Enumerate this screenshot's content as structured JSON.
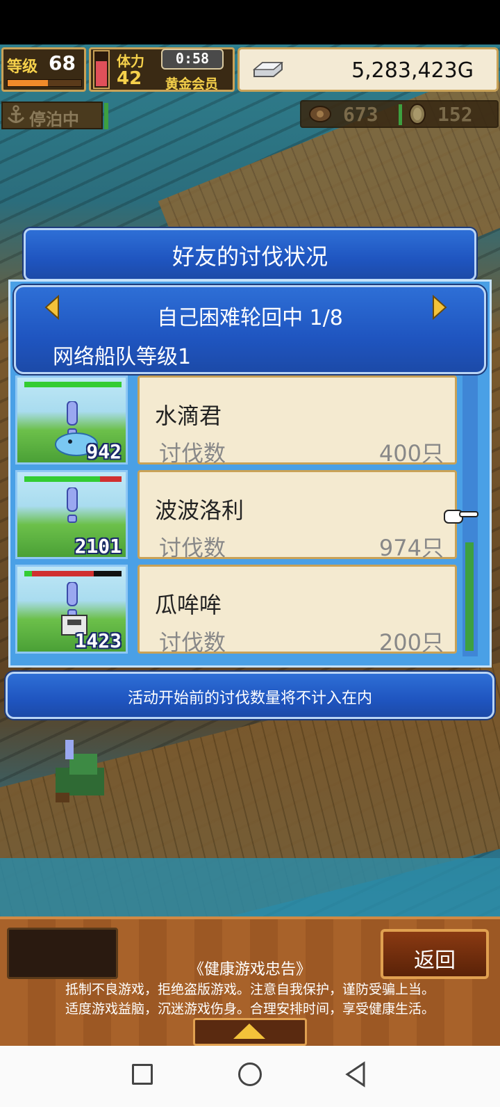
{
  "hud": {
    "level_label": "等级",
    "level_value": "68",
    "level_progress": 0.55,
    "stamina_label": "体力",
    "stamina_value": "42",
    "stamina_fraction": 0.75,
    "timer": "0:58",
    "member": "黄金会员",
    "gold": "5,283,423G",
    "anchor_status": "停泊中",
    "resource1": "673",
    "resource2": "152"
  },
  "dialog": {
    "title": "好友的讨伐状况",
    "header_line1": "自己困难轮回中 1/8",
    "header_line2": "网络船队等级1",
    "rows": [
      {
        "name": "水滴君",
        "label": "讨伐数",
        "count": "400只",
        "thumb_number": "942",
        "hp": 1.0,
        "hp_color": "#33cc33"
      },
      {
        "name": "波波洛利",
        "label": "讨伐数",
        "count": "974只",
        "thumb_number": "2101",
        "hp": 0.78,
        "hp_color": "#33cc33"
      },
      {
        "name": "瓜哞哞",
        "label": "讨伐数",
        "count": "200只",
        "thumb_number": "1423",
        "hp": 0.08,
        "hp_color": "#33cc33"
      }
    ],
    "notice": "活动开始前的讨伐数量将不计入在内"
  },
  "bottom": {
    "back_label": "返回",
    "advice_title": "《健康游戏忠告》",
    "advice_line1": "抵制不良游戏，拒绝盗版游戏。注意自我保护，谨防受骗上当。",
    "advice_line2": "适度游戏益脑，沉迷游戏伤身。合理安排时间，享受健康生活。"
  },
  "icons": {
    "gold": "silver-bar-icon",
    "anchor": "anchor-icon",
    "res1": "medal-icon",
    "res2": "coin-icon",
    "pointer": "pointing-hand-icon"
  }
}
